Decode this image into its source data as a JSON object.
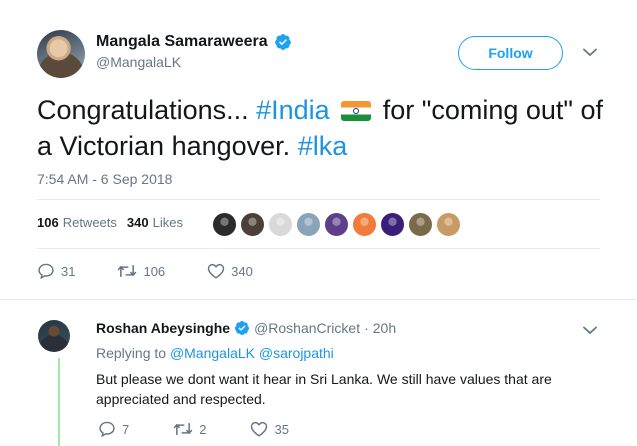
{
  "main_tweet": {
    "author": {
      "name": "Mangala Samaraweera",
      "handle": "@MangalaLK"
    },
    "follow_label": "Follow",
    "text": {
      "part1": "Congratulations... ",
      "hashtag1": "#India",
      "part2": " for \"coming out\" of a Victorian hangover. ",
      "hashtag2": "#lka"
    },
    "timestamp": "7:54 AM - 6 Sep 2018",
    "stats": {
      "retweets_count": "106",
      "retweets_label": "Retweets",
      "likes_count": "340",
      "likes_label": "Likes"
    },
    "likers": [
      "#2b2b2b",
      "#4a3f3a",
      "#d9d9d9",
      "#8aa3b8",
      "#5d3f8a",
      "#f07b3a",
      "#3a1f7a",
      "#7a6a4a",
      "#c89a64"
    ],
    "actions": {
      "replies": "31",
      "retweets": "106",
      "likes": "340"
    }
  },
  "reply": {
    "author": {
      "name": "Roshan Abeysinghe",
      "handle": "@RoshanCricket",
      "time": "20h"
    },
    "replying_prefix": "Replying to ",
    "replying_to": [
      "@MangalaLK",
      "@sarojpathi"
    ],
    "text": "But please we dont want it hear in Sri Lanka. We still have values that are appreciated and respected.",
    "actions": {
      "replies": "7",
      "retweets": "2",
      "likes": "35"
    }
  },
  "colors": {
    "accent": "#1da1f2",
    "link": "#1b95e0",
    "muted": "#657786",
    "thread_line": "#a3e6b0"
  },
  "icons": [
    "verified-badge-icon",
    "chevron-down-icon",
    "reply-icon",
    "retweet-icon",
    "like-icon",
    "india-flag-icon"
  ]
}
